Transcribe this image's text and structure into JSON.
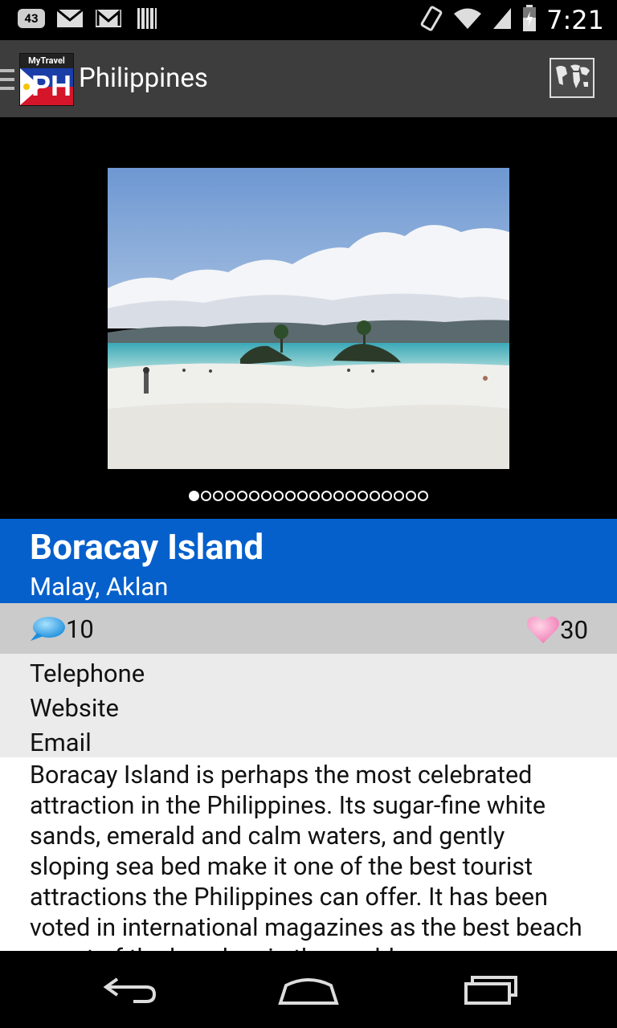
{
  "status": {
    "notification_count": "43",
    "time": "7:21",
    "icons": [
      "gmail-icon",
      "gmail-icon",
      "barcode-icon",
      "rotate-icon",
      "wifi-icon",
      "signal-icon",
      "battery-icon"
    ]
  },
  "actionbar": {
    "logo_text": "MyTravel",
    "logo_code": "PH",
    "title": "Philippines",
    "map_icon": "world-map-icon"
  },
  "gallery": {
    "total_images": 20,
    "active_index": 0
  },
  "place": {
    "name": "Boracay Island",
    "location": "Malay, Aklan",
    "comments": "10",
    "likes": "30"
  },
  "contacts": {
    "telephone": "Telephone",
    "website": "Website",
    "email": "Email"
  },
  "description": "Boracay Island is perhaps the most celebrated attraction in the Philippines.  Its sugar-fine white sands, emerald and calm waters, and gently sloping sea bed make it one of the best tourist attractions the Philippines can offer.  It has been voted in international magazines as the best beach resort of the beaches in the world.",
  "colors": {
    "accent": "#0660cc",
    "actionbar": "#3d3d3d",
    "stats": "#cbcbcb",
    "contacts": "#ebebeb"
  }
}
